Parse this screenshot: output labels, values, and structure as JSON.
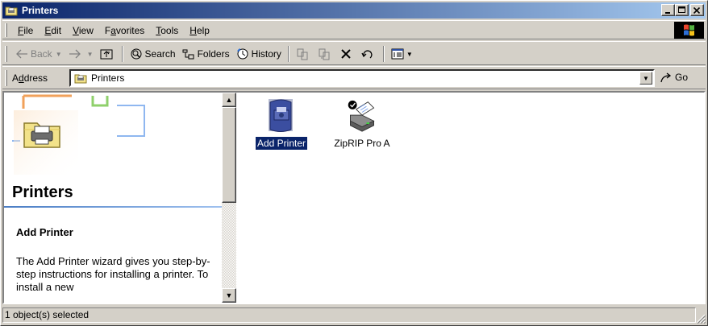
{
  "window": {
    "title": "Printers"
  },
  "menubar": {
    "items": [
      {
        "label": "File",
        "accel": "F",
        "rest": "ile"
      },
      {
        "label": "Edit",
        "accel": "E",
        "rest": "dit"
      },
      {
        "label": "View",
        "accel": "V",
        "rest": "iew"
      },
      {
        "label": "Favorites",
        "pre": "F",
        "accel": "a",
        "rest": "vorites"
      },
      {
        "label": "Tools",
        "accel": "T",
        "rest": "ools"
      },
      {
        "label": "Help",
        "accel": "H",
        "rest": "elp"
      }
    ]
  },
  "toolbar": {
    "back_label": "Back",
    "search_label": "Search",
    "folders_label": "Folders",
    "history_label": "History"
  },
  "address": {
    "label_pre": "A",
    "label_accel": "d",
    "label_rest": "dress",
    "value": "Printers",
    "go_label": "Go"
  },
  "leftpane": {
    "title": "Printers",
    "subheading": "Add Printer",
    "description": "The Add Printer wizard gives you step-by-step instructions for installing a printer. To install a new"
  },
  "items": [
    {
      "label": "Add Printer",
      "icon": "add-printer-icon",
      "selected": true
    },
    {
      "label": "ZipRIP Pro A",
      "icon": "printer-icon",
      "selected": false
    }
  ],
  "status": {
    "text": "1 object(s) selected"
  },
  "colors": {
    "titlebar_start": "#0a246a",
    "titlebar_end": "#a6caf0",
    "selection": "#0a246a",
    "face": "#d4d0c8"
  }
}
